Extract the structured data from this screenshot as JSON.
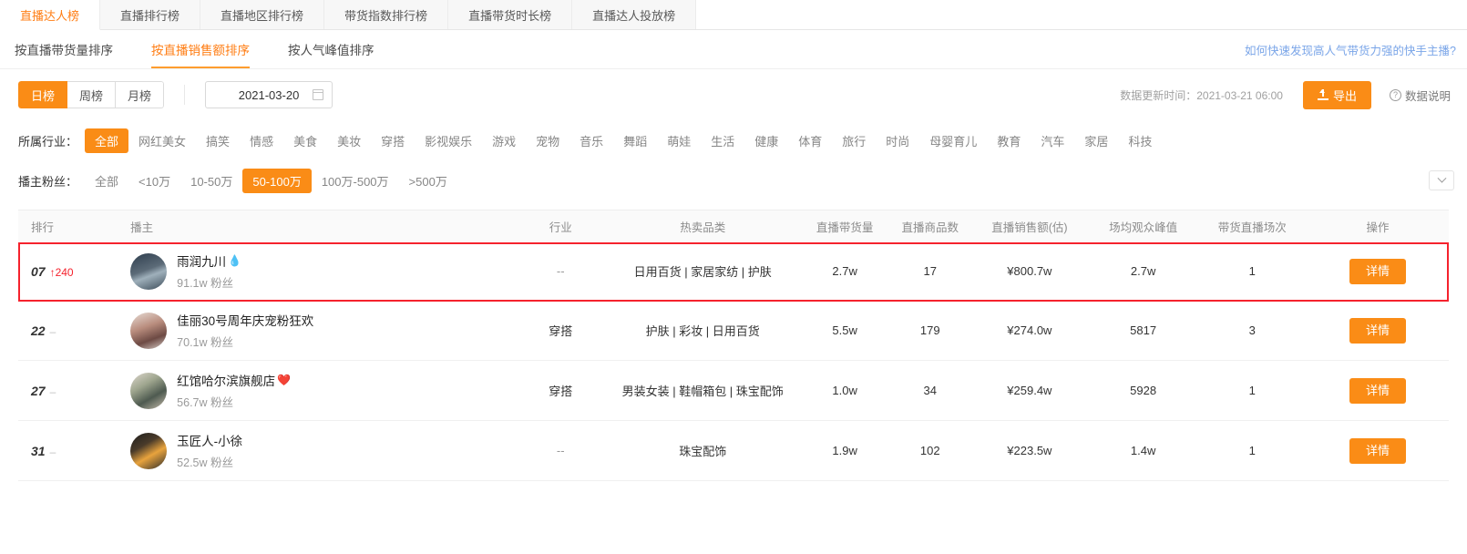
{
  "top_tabs": [
    {
      "label": "直播达人榜",
      "active": true
    },
    {
      "label": "直播排行榜",
      "active": false
    },
    {
      "label": "直播地区排行榜",
      "active": false
    },
    {
      "label": "带货指数排行榜",
      "active": false
    },
    {
      "label": "直播带货时长榜",
      "active": false
    },
    {
      "label": "直播达人投放榜",
      "active": false
    }
  ],
  "sub_tabs": [
    {
      "label": "按直播带货量排序",
      "active": false
    },
    {
      "label": "按直播销售额排序",
      "active": true
    },
    {
      "label": "按人气峰值排序",
      "active": false
    }
  ],
  "help_link": "如何快速发现高人气带货力强的快手主播?",
  "period": {
    "options": [
      {
        "label": "日榜",
        "active": true
      },
      {
        "label": "周榜",
        "active": false
      },
      {
        "label": "月榜",
        "active": false
      }
    ],
    "date_value": "2021-03-20",
    "calendar_icon": "calendar-icon"
  },
  "toolbar": {
    "update_time": "数据更新时间：2021-03-21 06:00",
    "export_label": "导出",
    "export_icon": "upload-icon",
    "data_note_label": "数据说明",
    "data_note_icon": "question-circle-icon"
  },
  "industry_filter": {
    "label": "所属行业：",
    "options": [
      {
        "label": "全部",
        "active": true
      },
      {
        "label": "网红美女",
        "active": false
      },
      {
        "label": "搞笑",
        "active": false
      },
      {
        "label": "情感",
        "active": false
      },
      {
        "label": "美食",
        "active": false
      },
      {
        "label": "美妆",
        "active": false
      },
      {
        "label": "穿搭",
        "active": false
      },
      {
        "label": "影视娱乐",
        "active": false
      },
      {
        "label": "游戏",
        "active": false
      },
      {
        "label": "宠物",
        "active": false
      },
      {
        "label": "音乐",
        "active": false
      },
      {
        "label": "舞蹈",
        "active": false
      },
      {
        "label": "萌娃",
        "active": false
      },
      {
        "label": "生活",
        "active": false
      },
      {
        "label": "健康",
        "active": false
      },
      {
        "label": "体育",
        "active": false
      },
      {
        "label": "旅行",
        "active": false
      },
      {
        "label": "时尚",
        "active": false
      },
      {
        "label": "母婴育儿",
        "active": false
      },
      {
        "label": "教育",
        "active": false
      },
      {
        "label": "汽车",
        "active": false
      },
      {
        "label": "家居",
        "active": false
      },
      {
        "label": "科技",
        "active": false
      }
    ]
  },
  "fans_filter": {
    "label": "播主粉丝：",
    "options": [
      {
        "label": "全部",
        "active": false
      },
      {
        "label": "<10万",
        "active": false
      },
      {
        "label": "10-50万",
        "active": false
      },
      {
        "label": "50-100万",
        "active": true
      },
      {
        "label": "100万-500万",
        "active": false
      },
      {
        "label": ">500万",
        "active": false
      }
    ],
    "collapse_icon": "chevron-down-icon"
  },
  "table": {
    "headers": [
      "排行",
      "播主",
      "行业",
      "热卖品类",
      "直播带货量",
      "直播商品数",
      "直播销售额(估)",
      "场均观众峰值",
      "带货直播场次",
      "操作"
    ],
    "action_label": "详情",
    "rows": [
      {
        "rank": "07",
        "delta": "↑240",
        "delta_type": "up",
        "name": "雨润九川",
        "name_emoji": "💧",
        "fans": "91.1w 粉丝",
        "industry": "--",
        "categories": "日用百货 | 家居家纺 | 护肤",
        "volume": "2.7w",
        "products": "17",
        "sales": "¥800.7w",
        "peak": "2.7w",
        "sessions": "1",
        "highlighted": true
      },
      {
        "rank": "22",
        "delta": "–",
        "delta_type": "flat",
        "name": "佳丽30号周年庆宠粉狂欢",
        "name_emoji": "",
        "fans": "70.1w 粉丝",
        "industry": "穿搭",
        "categories": "护肤 | 彩妆 | 日用百货",
        "volume": "5.5w",
        "products": "179",
        "sales": "¥274.0w",
        "peak": "5817",
        "sessions": "3",
        "highlighted": false
      },
      {
        "rank": "27",
        "delta": "–",
        "delta_type": "flat",
        "name": "红馆哈尔滨旗舰店",
        "name_emoji": "❤️",
        "fans": "56.7w 粉丝",
        "industry": "穿搭",
        "categories": "男装女装 | 鞋帽箱包 | 珠宝配饰",
        "volume": "1.0w",
        "products": "34",
        "sales": "¥259.4w",
        "peak": "5928",
        "sessions": "1",
        "highlighted": false
      },
      {
        "rank": "31",
        "delta": "–",
        "delta_type": "flat",
        "name": "玉匠人-小徐",
        "name_emoji": "",
        "fans": "52.5w 粉丝",
        "industry": "--",
        "categories": "珠宝配饰",
        "volume": "1.9w",
        "products": "102",
        "sales": "¥223.5w",
        "peak": "1.4w",
        "sessions": "1",
        "highlighted": false
      }
    ]
  },
  "colors": {
    "accent": "#fa8c16",
    "active_tab": "#ff7d13",
    "link": "#7aa5e8",
    "highlight_border": "#f5222d"
  }
}
